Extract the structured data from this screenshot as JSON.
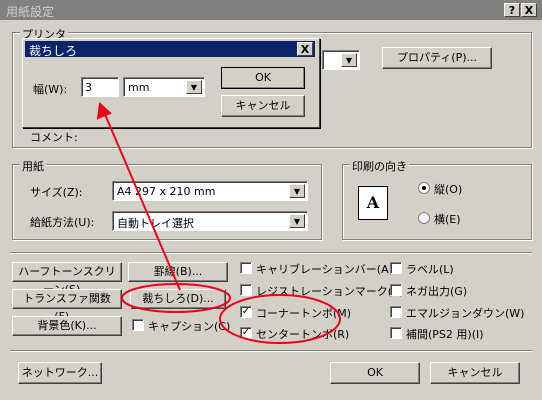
{
  "window": {
    "title": "用紙設定",
    "help_btn": "?",
    "close_btn": "X"
  },
  "printer_group": {
    "label": "プリンタ",
    "properties_button": "プロパティ(P)...",
    "comment_label": "コメント:"
  },
  "paper_group": {
    "label": "用紙",
    "size_label": "サイズ(Z):",
    "size_value": "A4 297 x 210 mm",
    "source_label": "給紙方法(U):",
    "source_value": "自動トレイ選択"
  },
  "orientation_group": {
    "label": "印刷の向き",
    "icon_letter": "A",
    "portrait": "縦(O)",
    "landscape": "横(E)",
    "selected": "portrait"
  },
  "buttons": {
    "halftone": "ハーフトーンスクリーン(S)...",
    "ruled": "罫線(B)...",
    "transfer": "トランスファ関数(F)...",
    "trim": "裁ちしろ(D)...",
    "background": "背景色(K)...",
    "network": "ネットワーク...",
    "ok": "OK",
    "cancel": "キャンセル"
  },
  "checkboxes": [
    {
      "label": "キャプション(C)",
      "checked": false
    },
    {
      "label": "キャリブレーションバー(A)",
      "checked": false
    },
    {
      "label": "レジストレーションマーク(T)",
      "checked": false
    },
    {
      "label": "コーナートンボ(M)",
      "checked": true
    },
    {
      "label": "センタートンボ(R)",
      "checked": true
    },
    {
      "label": "ラベル(L)",
      "checked": false
    },
    {
      "label": "ネガ出力(G)",
      "checked": false
    },
    {
      "label": "エマルジョンダウン(W)",
      "checked": false
    },
    {
      "label": "補間(PS2 用)(I)",
      "checked": false
    }
  ],
  "trim_dialog": {
    "title": "裁ちしろ",
    "close_btn": "X",
    "width_label": "幅(W):",
    "width_value": "3",
    "unit_value": "mm",
    "ok": "OK",
    "cancel": "キャンセル"
  },
  "annotation_color": "#e8001c"
}
